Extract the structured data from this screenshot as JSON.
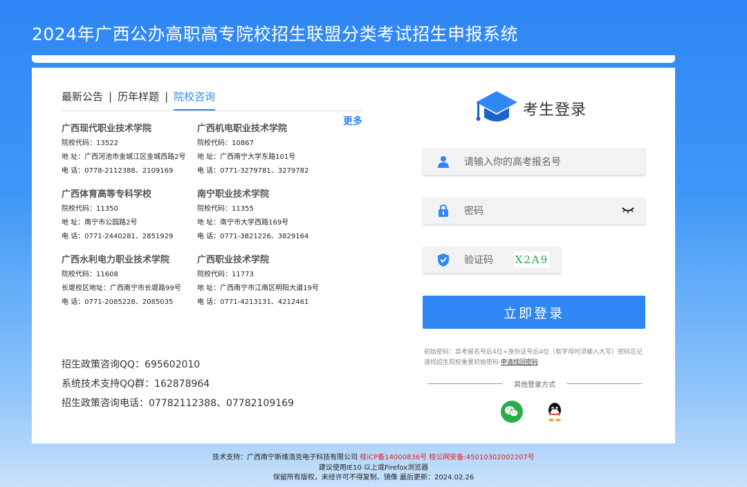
{
  "header": {
    "title": "2024年广西公办高职高专院校招生联盟分类考试招生申报系统"
  },
  "tabs": [
    {
      "label": "最新公告"
    },
    {
      "label": "历年样题"
    },
    {
      "label": "院校咨询"
    }
  ],
  "tab_separator": "|",
  "more_label": "更多",
  "schools": [
    {
      "name": "广西现代职业技术学院",
      "code": "院校代码：13522",
      "address": "地  址：广西河池市金城江区金城西路2号",
      "phone": "电  话：0778-2112388、2109169"
    },
    {
      "name": "广西机电职业技术学院",
      "code": "院校代码：10867",
      "address": "地  址：广西南宁大学东路101号",
      "phone": "电  话：0771-3279781、3279782"
    },
    {
      "name": "广西体育高等专科学校",
      "code": "院校代码：11350",
      "address": "地  址：南宁市公园路2号",
      "phone": "电  话：0771-2440281、2851929"
    },
    {
      "name": "南宁职业技术学院",
      "code": "院校代码：11355",
      "address": "地  址：南宁市大学西路169号",
      "phone": "电  话：0771-3821226、3829164"
    },
    {
      "name": "广西水利电力职业技术学院",
      "code": "院校代码：11608",
      "address": "长堤校区地址：广西南宁市长堤路99号",
      "phone": "电  话：0771-2085228、2085035"
    },
    {
      "name": "广西职业技术学院",
      "code": "院校代码：11773",
      "address": "地  址：广西南宁市江南区明阳大道19号",
      "phone": "电  话：0771-4213131、4212461"
    }
  ],
  "contacts": [
    "招生政策咨询QQ：695602010",
    "系统技术支持QQ群：162878964",
    "招生政策咨询电话：07782112388、07782109169"
  ],
  "login": {
    "title": "考生登录",
    "username_placeholder": "请输入你的高考报名号",
    "password_placeholder": "密码",
    "captcha_placeholder": "验证码",
    "captcha_text": "X2A9",
    "submit_label": "立即登录",
    "hint_text": "初始密码：高考报名号后4位+身份证号后4位（有字母时须输入大写）密码忘记请找招生院校重置初始密码",
    "hint_link": "申请找回密码",
    "other_login_label": "其他登录方式"
  },
  "footer": {
    "tech_support": "技术支持：广西南宁斯维浩克电子科技有限公司",
    "icp": "桂ICP备14000836号",
    "police": "桂公网安备:45010302002207号",
    "browser_note": "建议使用IE10 以上或Firefox浏览器",
    "copyright": "保留所有版权，未经许可不得复制、镜像  最后更新：2024.02.26"
  },
  "colors": {
    "primary": "#2f86f5",
    "wechat": "#2aae4a",
    "footer_red": "#e02020"
  }
}
